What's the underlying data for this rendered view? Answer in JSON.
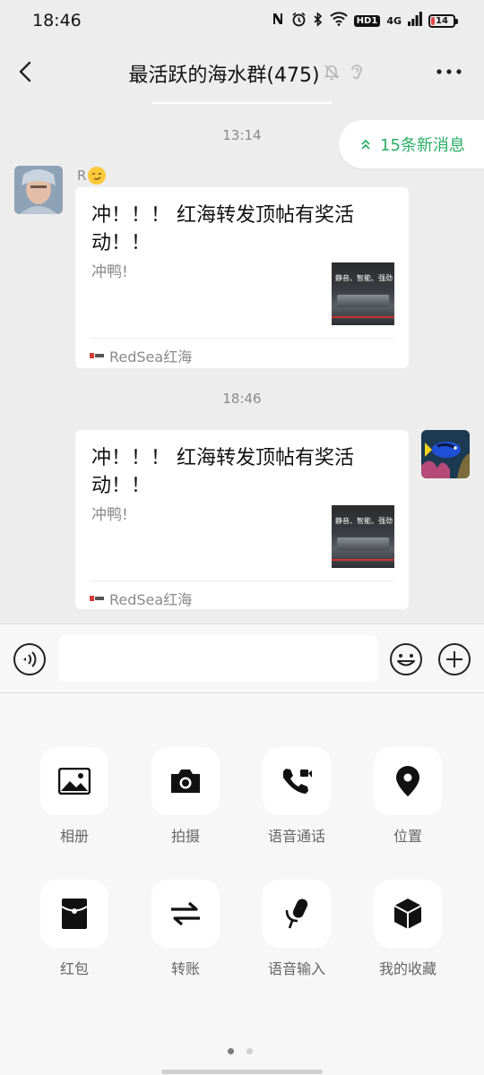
{
  "status_bar": {
    "time": "18:46",
    "network": "4G",
    "hd_label": "HD1",
    "battery_level": "14",
    "battery_percent": 14,
    "icons": [
      "nfc-icon",
      "alarm-icon",
      "bluetooth-icon",
      "wifi-icon",
      "hd-icon",
      "signal-icon",
      "battery-icon"
    ]
  },
  "header": {
    "title": "最活跃的海水群(475)",
    "icons": [
      "back-icon",
      "mute-bell-icon",
      "ear-icon",
      "more-icon"
    ]
  },
  "chat": {
    "new_messages": "15条新消息",
    "messages": [
      {
        "time": "13:14",
        "sender_name": "R",
        "sender_emoji": "smirk-emoji",
        "direction": "incoming",
        "card": {
          "title": "冲！！！ 红海转发顶帖有奖活动！！",
          "description": "冲鸭!",
          "thumb_text": "静音、智能、强劲",
          "source": "RedSea红海"
        }
      },
      {
        "time": "18:46",
        "direction": "outgoing",
        "card": {
          "title": "冲！！！ 红海转发顶帖有奖活动！！",
          "description": "冲鸭!",
          "thumb_text": "静音、智能、强劲",
          "source": "RedSea红海"
        }
      }
    ]
  },
  "input_bar": {
    "value": "",
    "icons": [
      "voice-icon",
      "emoji-icon",
      "plus-icon"
    ]
  },
  "panel": {
    "tools": [
      {
        "label": "相册",
        "icon": "photo-album-icon"
      },
      {
        "label": "拍摄",
        "icon": "camera-icon"
      },
      {
        "label": "语音通话",
        "icon": "voice-call-icon"
      },
      {
        "label": "位置",
        "icon": "location-icon"
      },
      {
        "label": "红包",
        "icon": "red-packet-icon"
      },
      {
        "label": "转账",
        "icon": "transfer-icon"
      },
      {
        "label": "语音输入",
        "icon": "microphone-icon"
      },
      {
        "label": "我的收藏",
        "icon": "favorites-icon"
      }
    ],
    "page_count": 2,
    "active_page": 1
  },
  "colors": {
    "background": "#ededed",
    "accent_green": "#2aae67",
    "panel_bg": "#f7f7f7"
  }
}
